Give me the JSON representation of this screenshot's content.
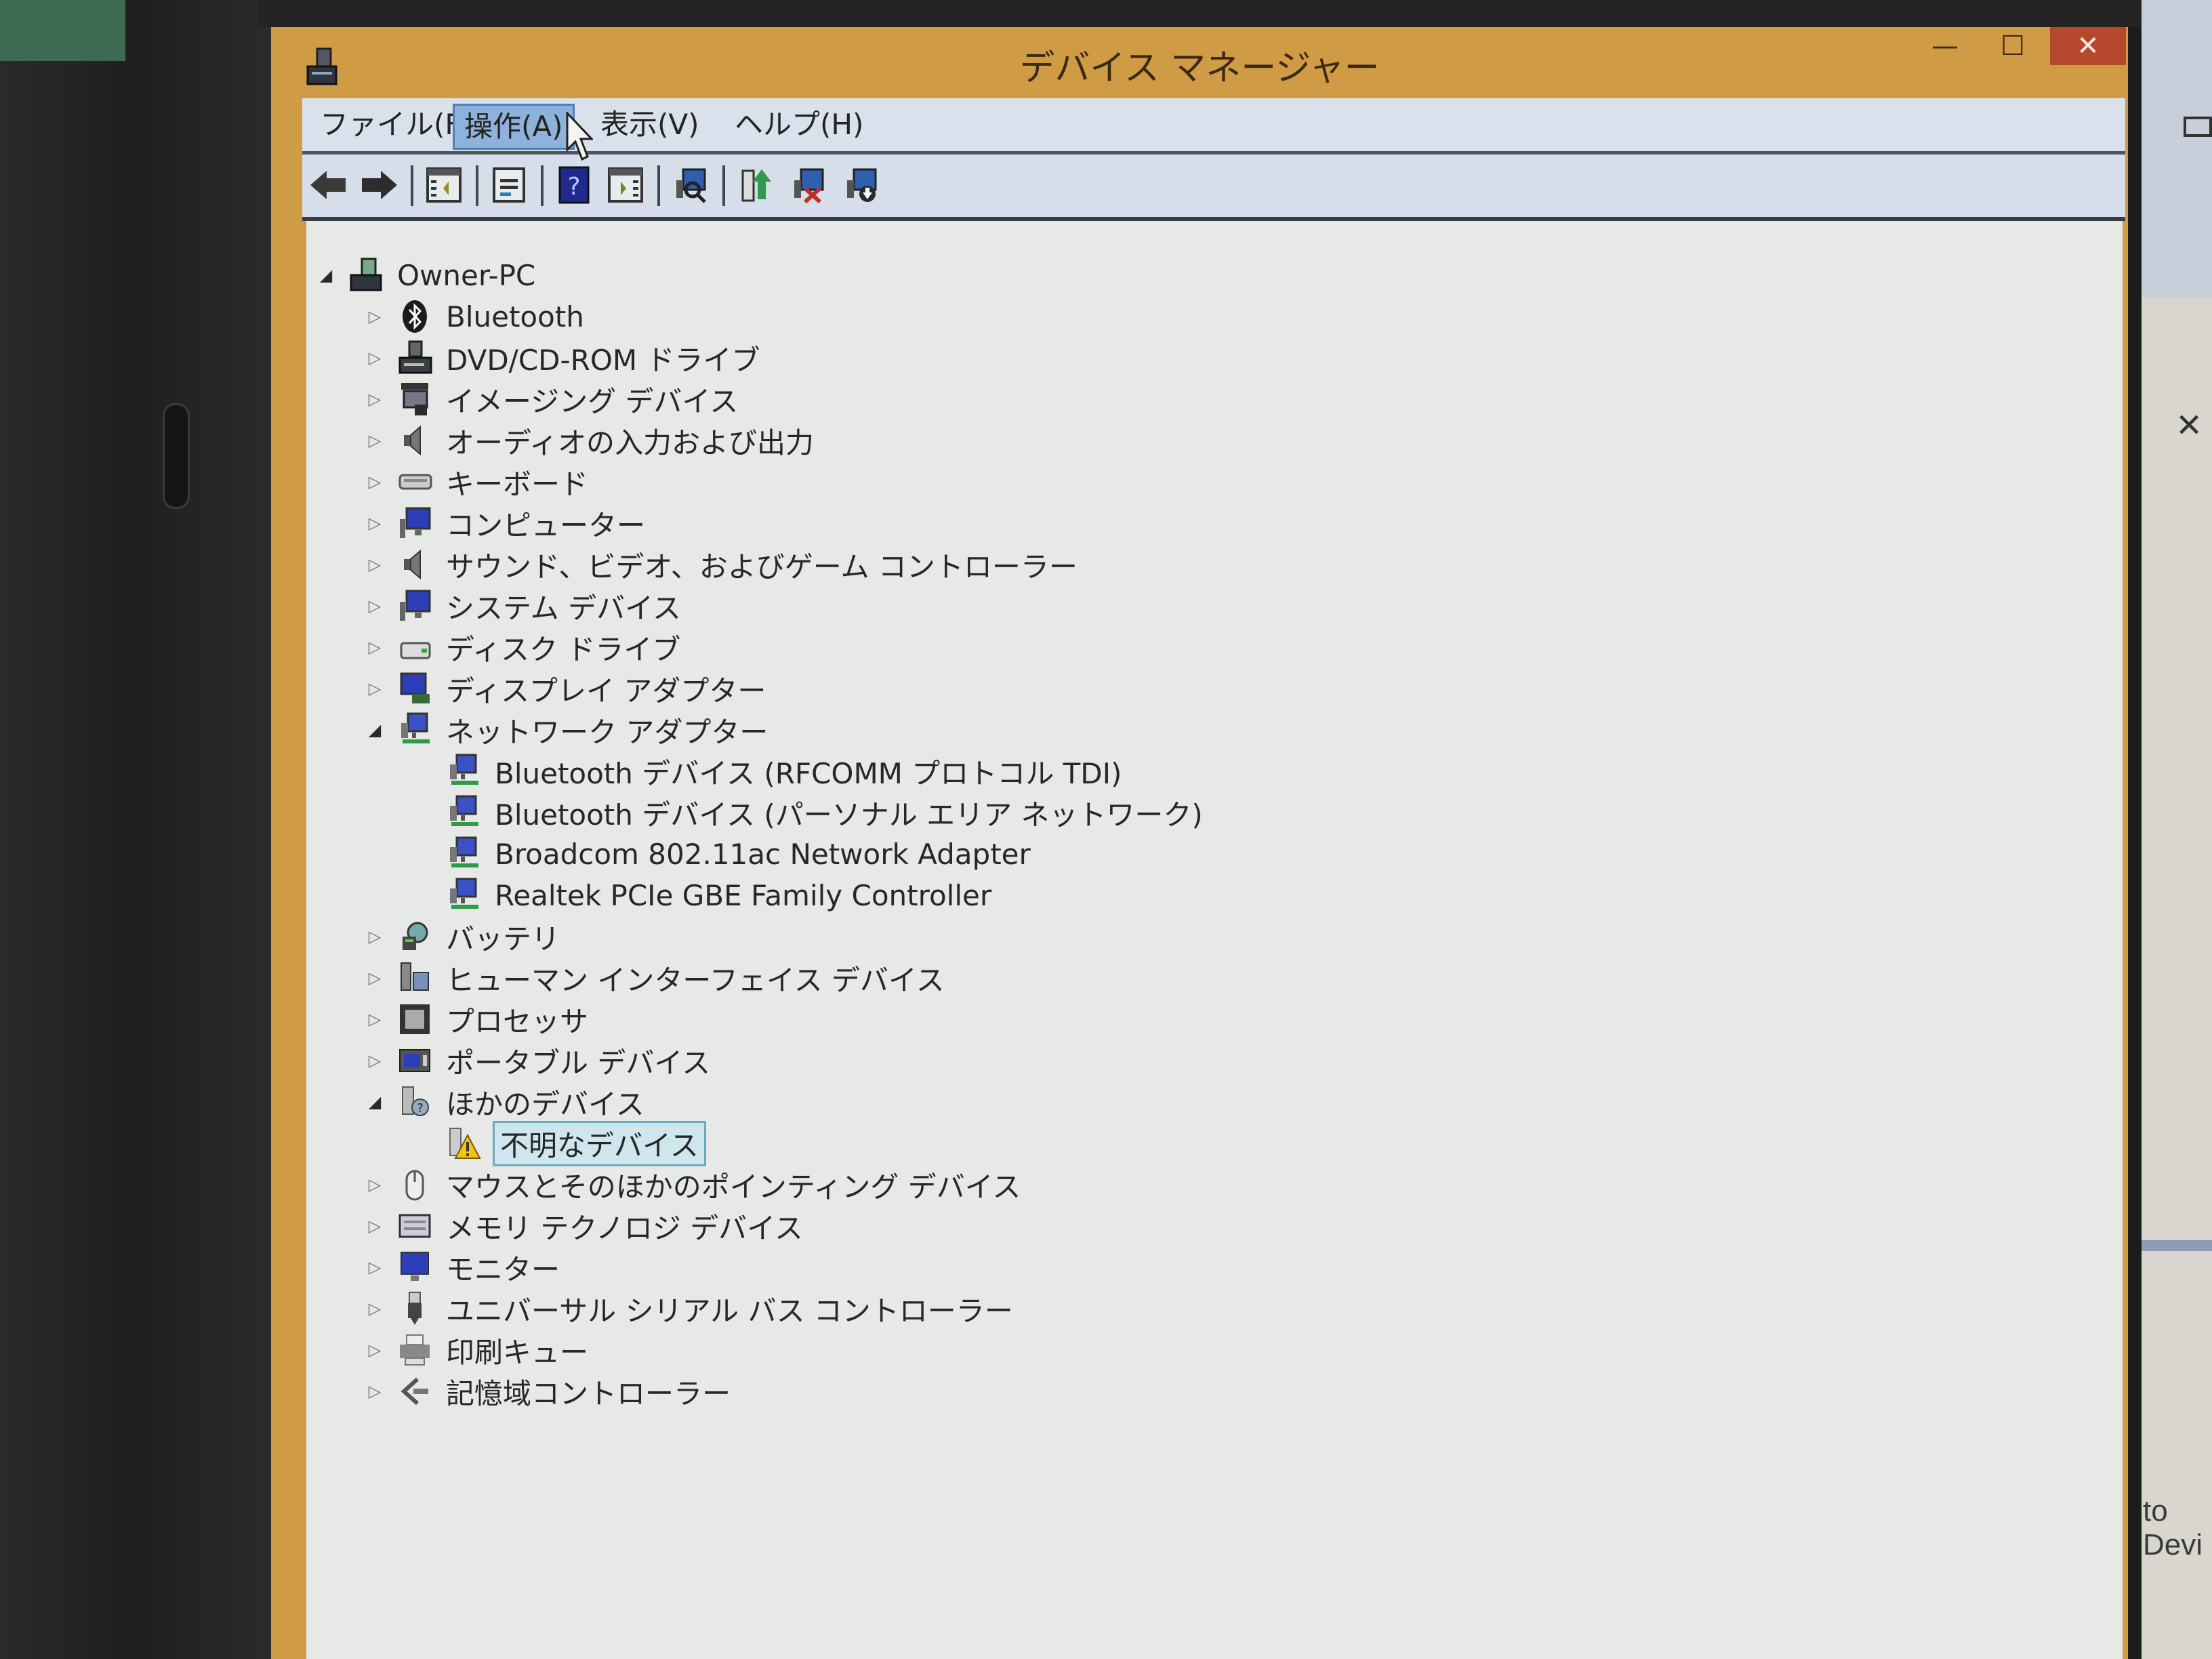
{
  "window": {
    "title": "デバイス マネージャー",
    "controls": {
      "minimize": "—",
      "maximize": "☐",
      "close": "✕"
    }
  },
  "menu": [
    {
      "label": "ファイル(F)",
      "active": false
    },
    {
      "label": "操作(A)",
      "active": true
    },
    {
      "label": "表示(V)",
      "active": false
    },
    {
      "label": "ヘルプ(H)",
      "active": false
    }
  ],
  "toolbar": [
    {
      "icon": "back-arrow-icon"
    },
    {
      "icon": "forward-arrow-icon"
    },
    {
      "icon": "show-hide-console-tree-icon"
    },
    {
      "icon": "properties-icon"
    },
    {
      "icon": "help-icon"
    },
    {
      "icon": "show-hide-action-pane-icon"
    },
    {
      "icon": "scan-hardware-changes-icon"
    },
    {
      "icon": "update-driver-icon"
    },
    {
      "icon": "uninstall-device-icon"
    },
    {
      "icon": "disable-device-icon"
    }
  ],
  "tree": [
    {
      "label": "Owner-PC",
      "level": 0,
      "state": "open",
      "icon": "computer-root-icon"
    },
    {
      "label": "Bluetooth",
      "level": 1,
      "state": "closed",
      "icon": "bluetooth-icon"
    },
    {
      "label": "DVD/CD-ROM ドライブ",
      "level": 1,
      "state": "closed",
      "icon": "dvd-drive-icon"
    },
    {
      "label": "イメージング デバイス",
      "level": 1,
      "state": "closed",
      "icon": "imaging-device-icon"
    },
    {
      "label": "オーディオの入力および出力",
      "level": 1,
      "state": "closed",
      "icon": "speaker-icon"
    },
    {
      "label": "キーボード",
      "level": 1,
      "state": "closed",
      "icon": "keyboard-icon"
    },
    {
      "label": "コンピューター",
      "level": 1,
      "state": "closed",
      "icon": "computer-icon"
    },
    {
      "label": "サウンド、ビデオ、およびゲーム コントローラー",
      "level": 1,
      "state": "closed",
      "icon": "speaker-icon"
    },
    {
      "label": "システム デバイス",
      "level": 1,
      "state": "closed",
      "icon": "system-device-icon"
    },
    {
      "label": "ディスク ドライブ",
      "level": 1,
      "state": "closed",
      "icon": "disk-drive-icon"
    },
    {
      "label": "ディスプレイ アダプター",
      "level": 1,
      "state": "closed",
      "icon": "display-adapter-icon"
    },
    {
      "label": "ネットワーク アダプター",
      "level": 1,
      "state": "open",
      "icon": "network-adapter-icon"
    },
    {
      "label": "Bluetooth デバイス (RFCOMM プロトコル TDI)",
      "level": 2,
      "state": "leaf",
      "icon": "network-adapter-icon"
    },
    {
      "label": "Bluetooth デバイス (パーソナル エリア ネットワーク)",
      "level": 2,
      "state": "leaf",
      "icon": "network-adapter-icon"
    },
    {
      "label": "Broadcom 802.11ac Network Adapter",
      "level": 2,
      "state": "leaf",
      "icon": "network-adapter-icon"
    },
    {
      "label": "Realtek PCIe GBE Family Controller",
      "level": 2,
      "state": "leaf",
      "icon": "network-adapter-icon"
    },
    {
      "label": "バッテリ",
      "level": 1,
      "state": "closed",
      "icon": "battery-icon"
    },
    {
      "label": "ヒューマン インターフェイス デバイス",
      "level": 1,
      "state": "closed",
      "icon": "hid-icon"
    },
    {
      "label": "プロセッサ",
      "level": 1,
      "state": "closed",
      "icon": "processor-icon"
    },
    {
      "label": "ポータブル デバイス",
      "level": 1,
      "state": "closed",
      "icon": "portable-device-icon"
    },
    {
      "label": "ほかのデバイス",
      "level": 1,
      "state": "open",
      "icon": "other-devices-icon"
    },
    {
      "label": "不明なデバイス",
      "level": 2,
      "state": "leaf",
      "icon": "unknown-device-warning-icon",
      "selected": true
    },
    {
      "label": "マウスとそのほかのポインティング デバイス",
      "level": 1,
      "state": "closed",
      "icon": "mouse-icon"
    },
    {
      "label": "メモリ テクノロジ デバイス",
      "level": 1,
      "state": "closed",
      "icon": "memory-device-icon"
    },
    {
      "label": "モニター",
      "level": 1,
      "state": "closed",
      "icon": "monitor-icon"
    },
    {
      "label": "ユニバーサル シリアル バス コントローラー",
      "level": 1,
      "state": "closed",
      "icon": "usb-icon"
    },
    {
      "label": "印刷キュー",
      "level": 1,
      "state": "closed",
      "icon": "printer-icon"
    },
    {
      "label": "記憶域コントローラー",
      "level": 1,
      "state": "closed",
      "icon": "storage-controller-icon"
    }
  ],
  "background_window": {
    "partial_text": "to Devi",
    "close": "✕"
  },
  "colors": {
    "titlebar": "#cf9b45",
    "close_button": "#b5482d",
    "menu_active": "#8eb2dc",
    "selection": "#cfe6ee",
    "content_bg": "#e6e9e6"
  }
}
